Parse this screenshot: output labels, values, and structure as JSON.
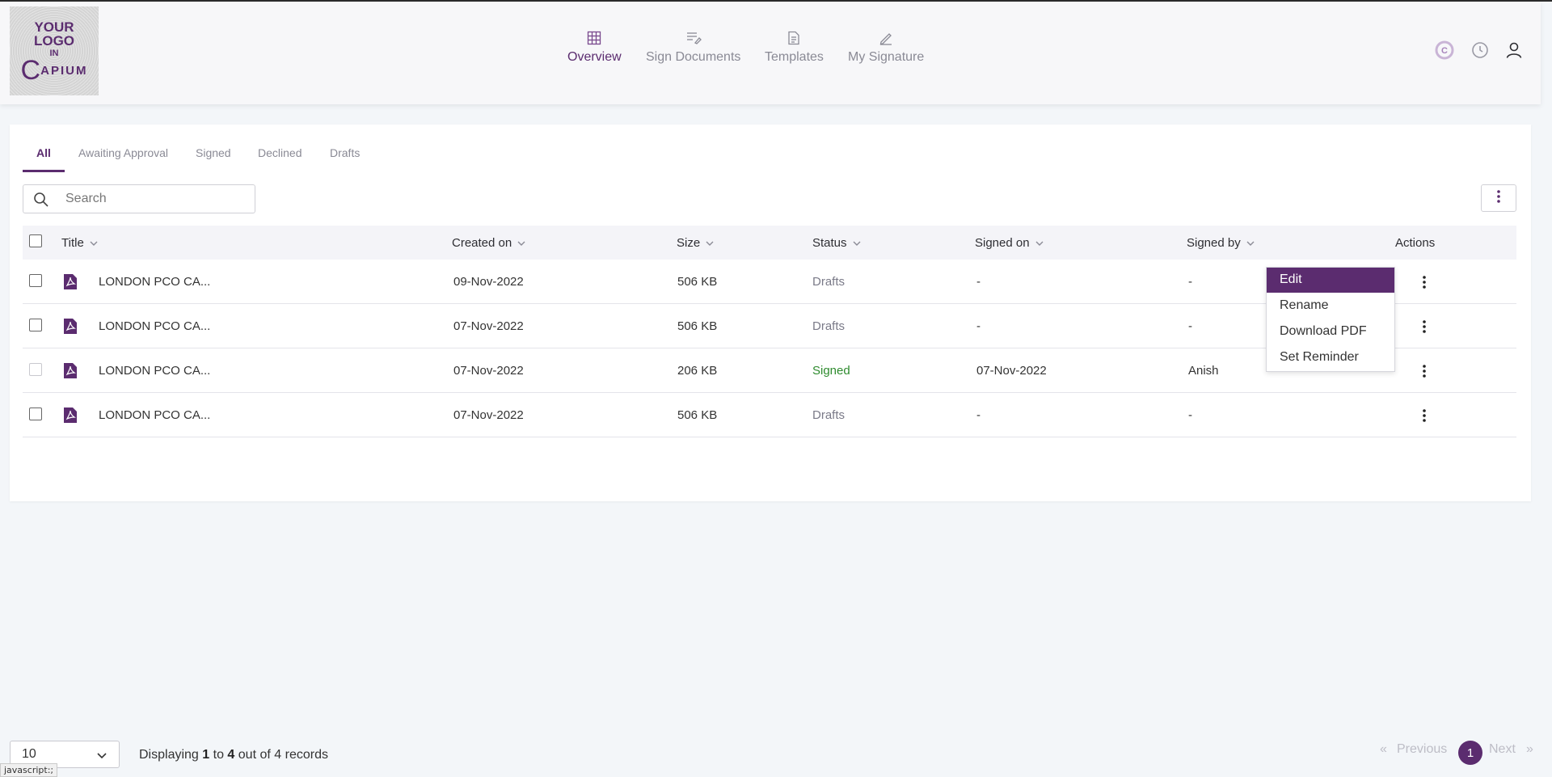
{
  "logo": {
    "line1": "YOUR",
    "line2": "LOGO",
    "line3": "IN",
    "line4": "APIUM",
    "mark": "C"
  },
  "nav": [
    {
      "label": "Overview",
      "icon": "grid-icon",
      "active": true
    },
    {
      "label": "Sign Documents",
      "icon": "sign-document-icon",
      "active": false
    },
    {
      "label": "Templates",
      "icon": "template-icon",
      "active": false
    },
    {
      "label": "My Signature",
      "icon": "pen-icon",
      "active": false
    }
  ],
  "header_icons": [
    "capium-brand-icon",
    "history-clock-icon",
    "user-profile-icon"
  ],
  "tabs": [
    {
      "label": "All",
      "active": true
    },
    {
      "label": "Awaiting Approval",
      "active": false
    },
    {
      "label": "Signed",
      "active": false
    },
    {
      "label": "Declined",
      "active": false
    },
    {
      "label": "Drafts",
      "active": false
    }
  ],
  "search": {
    "placeholder": "Search",
    "value": ""
  },
  "table": {
    "columns": [
      "Title",
      "Created on",
      "Size",
      "Status",
      "Signed on",
      "Signed by",
      "Actions"
    ],
    "rows": [
      {
        "title": "LONDON PCO CA...",
        "created_on": "09-Nov-2022",
        "size": "506 KB",
        "status": "Drafts",
        "signed_on": "-",
        "signed_by": "-"
      },
      {
        "title": "LONDON PCO CA...",
        "created_on": "07-Nov-2022",
        "size": "506 KB",
        "status": "Drafts",
        "signed_on": "-",
        "signed_by": "-"
      },
      {
        "title": "LONDON PCO CA...",
        "created_on": "07-Nov-2022",
        "size": "206 KB",
        "status": "Signed",
        "signed_on": "07-Nov-2022",
        "signed_by": "Anish"
      },
      {
        "title": "LONDON PCO CA...",
        "created_on": "07-Nov-2022",
        "size": "506 KB",
        "status": "Drafts",
        "signed_on": "-",
        "signed_by": "-"
      }
    ]
  },
  "row_menu": {
    "items": [
      "Edit",
      "Rename",
      "Download PDF",
      "Set Reminder"
    ],
    "highlighted": "Edit"
  },
  "footer": {
    "page_size": "10",
    "records_prefix": "Displaying",
    "records_from": "1",
    "records_to_word": "to",
    "records_to": "4",
    "records_out_of": "out of",
    "records_total": "4",
    "records_suffix": "records",
    "prev_arrow": "«",
    "prev_label": "Previous",
    "current_page": "1",
    "next_label": "Next",
    "next_arrow": "»"
  },
  "status_bar": "javascript:;",
  "colors": {
    "accent": "#5b2c6f",
    "signed": "#2e8b2e",
    "drafts": "#7a7a88"
  }
}
